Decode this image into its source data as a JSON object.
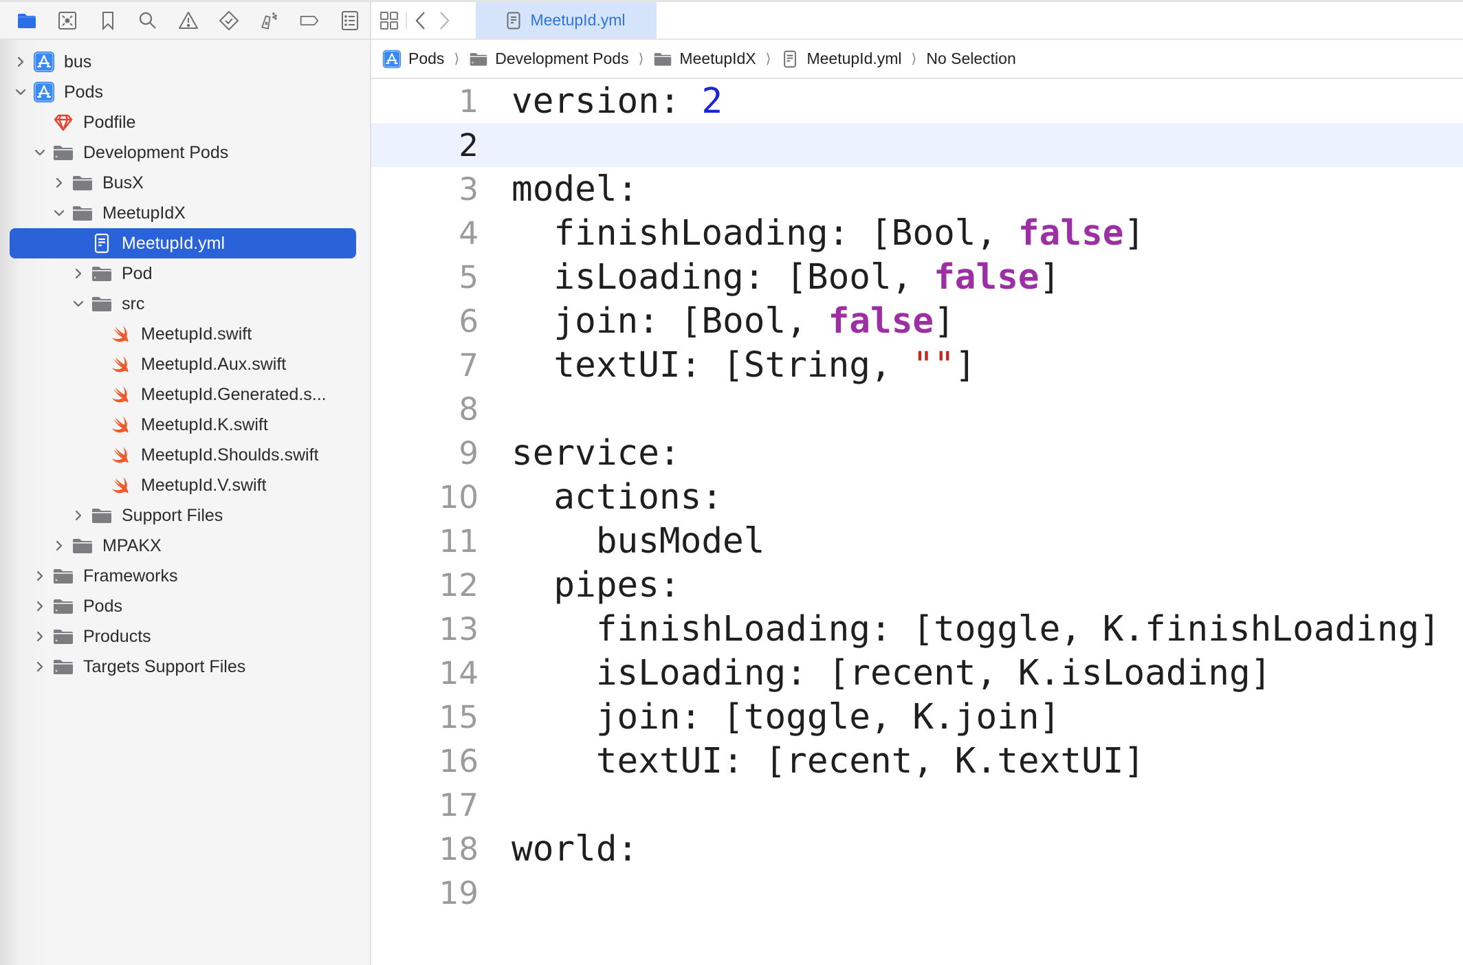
{
  "navigator": {
    "toolbar": [
      {
        "name": "project-navigator",
        "icon": "folder-icon",
        "active": true
      },
      {
        "name": "source-control-navigator",
        "icon": "source-control-icon"
      },
      {
        "name": "bookmark-navigator",
        "icon": "bookmark-icon"
      },
      {
        "name": "find-navigator",
        "icon": "search-icon"
      },
      {
        "name": "issue-navigator",
        "icon": "warning-icon"
      },
      {
        "name": "test-navigator",
        "icon": "test-diamond-icon"
      },
      {
        "name": "debug-navigator",
        "icon": "spray-icon"
      },
      {
        "name": "breakpoint-navigator",
        "icon": "breakpoint-icon"
      },
      {
        "name": "report-navigator",
        "icon": "report-list-icon"
      }
    ],
    "tree": [
      {
        "label": "bus",
        "level": 0,
        "icon": "xcode-project-icon",
        "expanded": false,
        "has_children": true
      },
      {
        "label": "Pods",
        "level": 0,
        "icon": "xcode-project-icon",
        "expanded": true,
        "has_children": true
      },
      {
        "label": "Podfile",
        "level": 1,
        "icon": "ruby-gem-icon",
        "has_children": false
      },
      {
        "label": "Development Pods",
        "level": 1,
        "icon": "group-folder-icon",
        "expanded": true,
        "has_children": true
      },
      {
        "label": "BusX",
        "level": 2,
        "icon": "folder-icon",
        "expanded": false,
        "has_children": true
      },
      {
        "label": "MeetupIdX",
        "level": 2,
        "icon": "folder-icon",
        "expanded": true,
        "has_children": true
      },
      {
        "label": "MeetupId.yml",
        "level": 3,
        "icon": "document-icon",
        "has_children": false,
        "selected": true
      },
      {
        "label": "Pod",
        "level": 3,
        "icon": "group-folder-icon",
        "expanded": false,
        "has_children": true
      },
      {
        "label": "src",
        "level": 3,
        "icon": "folder-icon",
        "expanded": true,
        "has_children": true
      },
      {
        "label": "MeetupId.swift",
        "level": 4,
        "icon": "swift-icon",
        "has_children": false
      },
      {
        "label": "MeetupId.Aux.swift",
        "level": 4,
        "icon": "swift-icon",
        "has_children": false
      },
      {
        "label": "MeetupId.Generated.s...",
        "level": 4,
        "icon": "swift-icon",
        "has_children": false
      },
      {
        "label": "MeetupId.K.swift",
        "level": 4,
        "icon": "swift-icon",
        "has_children": false
      },
      {
        "label": "MeetupId.Shoulds.swift",
        "level": 4,
        "icon": "swift-icon",
        "has_children": false
      },
      {
        "label": "MeetupId.V.swift",
        "level": 4,
        "icon": "swift-icon",
        "has_children": false
      },
      {
        "label": "Support Files",
        "level": 3,
        "icon": "folder-icon",
        "expanded": false,
        "has_children": true
      },
      {
        "label": "MPAKX",
        "level": 2,
        "icon": "folder-icon",
        "expanded": false,
        "has_children": true
      },
      {
        "label": "Frameworks",
        "level": 1,
        "icon": "group-folder-icon",
        "expanded": false,
        "has_children": true
      },
      {
        "label": "Pods",
        "level": 1,
        "icon": "group-folder-icon",
        "expanded": false,
        "has_children": true
      },
      {
        "label": "Products",
        "level": 1,
        "icon": "group-folder-icon",
        "expanded": false,
        "has_children": true
      },
      {
        "label": "Targets Support Files",
        "level": 1,
        "icon": "group-folder-icon",
        "expanded": false,
        "has_children": true
      }
    ]
  },
  "tabbar": {
    "active_tab": "MeetupId.yml"
  },
  "breadcrumb": [
    {
      "label": "Pods",
      "icon": "xcode-project-icon"
    },
    {
      "label": "Development Pods",
      "icon": "group-folder-icon"
    },
    {
      "label": "MeetupIdX",
      "icon": "folder-icon"
    },
    {
      "label": "MeetupId.yml",
      "icon": "document-icon"
    },
    {
      "label": "No Selection",
      "icon": null
    }
  ],
  "editor": {
    "current_line": 2,
    "lines": [
      [
        {
          "t": "version: "
        },
        {
          "t": "2",
          "k": "num"
        }
      ],
      [],
      [
        {
          "t": "model:"
        }
      ],
      [
        {
          "t": "  finishLoading: [Bool, "
        },
        {
          "t": "false",
          "k": "kw"
        },
        {
          "t": "]"
        }
      ],
      [
        {
          "t": "  isLoading: [Bool, "
        },
        {
          "t": "false",
          "k": "kw"
        },
        {
          "t": "]"
        }
      ],
      [
        {
          "t": "  join: [Bool, "
        },
        {
          "t": "false",
          "k": "kw"
        },
        {
          "t": "]"
        }
      ],
      [
        {
          "t": "  textUI: [String, "
        },
        {
          "t": "\"\"",
          "k": "str"
        },
        {
          "t": "]"
        }
      ],
      [],
      [
        {
          "t": "service:"
        }
      ],
      [
        {
          "t": "  actions:"
        }
      ],
      [
        {
          "t": "    busModel"
        }
      ],
      [
        {
          "t": "  pipes:"
        }
      ],
      [
        {
          "t": "    finishLoading: [toggle, K.finishLoading]"
        }
      ],
      [
        {
          "t": "    isLoading: [recent, K.isLoading]"
        }
      ],
      [
        {
          "t": "    join: [toggle, K.join]"
        }
      ],
      [
        {
          "t": "    textUI: [recent, K.textUI]"
        }
      ],
      [],
      [
        {
          "t": "world:"
        }
      ],
      []
    ]
  },
  "colors": {
    "accent": "#2a63d9",
    "tab_bg": "#d5e4fb",
    "tab_text": "#2f73e0",
    "number": "#1a24d6",
    "keyword": "#9b2fa3",
    "string": "#c4271c",
    "swift": "#f05a28",
    "gem": "#e8432e"
  }
}
